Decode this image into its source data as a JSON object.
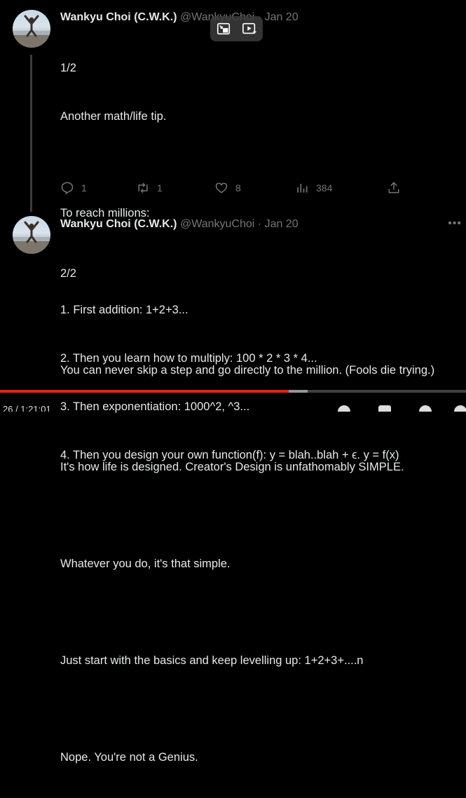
{
  "tweets": [
    {
      "name": "Wankyu Choi (C.W.K.)",
      "handle": "@WankyuChoi",
      "dot": "·",
      "date": "Jan 20",
      "lines": [
        "1/2",
        "Another math/life tip.",
        "",
        "To reach millions:",
        "",
        "1. First addition: 1+2+3...",
        "2. Then you learn how to multiply: 100 * 2 * 3 * 4...",
        "3. Then exponentiation: 1000^2, ^3...",
        "4. Then you design your own function(f): y = blah..blah + ϵ. y = f(x)"
      ],
      "actions": {
        "replies": "1",
        "retweets": "1",
        "likes": "8",
        "views": "384"
      }
    },
    {
      "name": "Wankyu Choi (C.W.K.)",
      "handle": "@WankyuChoi",
      "dot": "·",
      "date": "Jan 20",
      "lines": [
        "2/2",
        "",
        "You can never skip a step and go directly to the million. (Fools die trying.)",
        "",
        "It's how life is designed. Creator's Design is unfathomably SIMPLE.",
        "",
        "Whatever you do, it's that simple.",
        "",
        "Just start with the basics and keep levelling up: 1+2+3+....n",
        "",
        "Nope. You're not a Genius."
      ]
    }
  ],
  "more_icon": "more-horizontal-icon",
  "video": {
    "played_fraction": 0.62,
    "buffered_fraction": 0.66,
    "time": "26 / 1:21:01",
    "accent": "#e62117"
  }
}
